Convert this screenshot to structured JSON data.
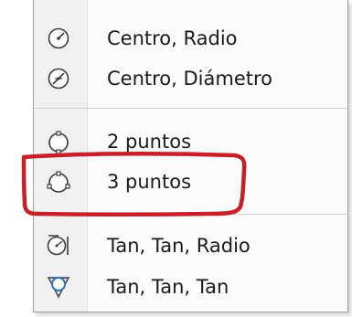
{
  "menu": {
    "items": [
      {
        "label": "Centro, Radio",
        "icon": "circle-center-radius-icon"
      },
      {
        "label": "Centro, Diámetro",
        "icon": "circle-center-diameter-icon"
      },
      {
        "label": "2 puntos",
        "icon": "circle-2-points-icon"
      },
      {
        "label": "3 puntos",
        "icon": "circle-3-points-icon"
      },
      {
        "label": "Tan, Tan, Radio",
        "icon": "circle-tan-tan-radius-icon"
      },
      {
        "label": "Tan, Tan, Tan",
        "icon": "circle-tan-tan-tan-icon"
      }
    ]
  },
  "annotation": {
    "highlight_color": "#c8202a",
    "highlighted_item": "3 puntos"
  }
}
